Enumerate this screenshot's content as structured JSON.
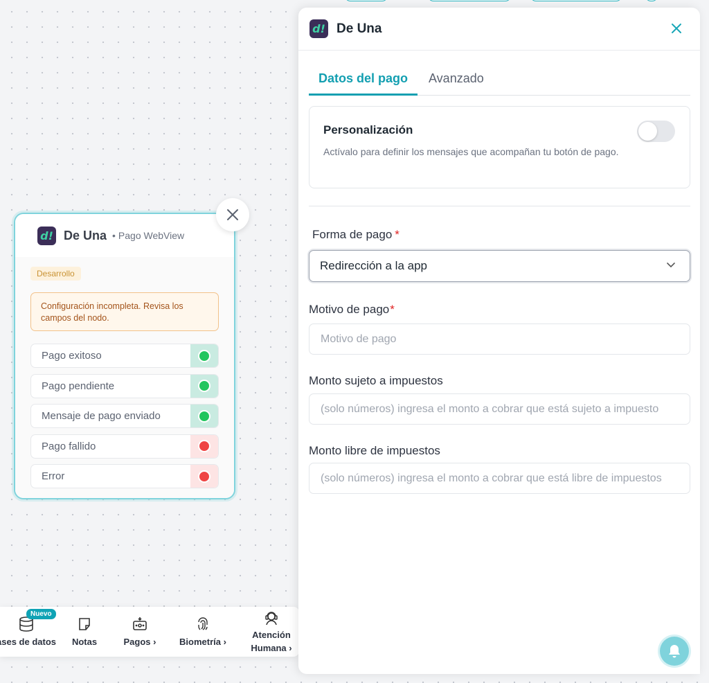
{
  "node": {
    "title": "De Una",
    "subtitle": "Pago WebView",
    "logo_text": "d!",
    "status_badge": "Desarrollo",
    "warning": "Configuración incompleta. Revisa los campos del nodo.",
    "outputs": [
      {
        "label": "Pago exitoso",
        "status": "success"
      },
      {
        "label": "Pago pendiente",
        "status": "success"
      },
      {
        "label": "Mensaje de pago enviado",
        "status": "success"
      },
      {
        "label": "Pago fallido",
        "status": "error"
      },
      {
        "label": "Error",
        "status": "error"
      }
    ]
  },
  "toolbar": {
    "new_badge": "Nuevo",
    "items": [
      {
        "label": "ases de datos",
        "icon": "database-icon"
      },
      {
        "label": "Notas",
        "icon": "note-icon"
      },
      {
        "label": "Pagos ›",
        "icon": "payments-icon"
      },
      {
        "label": "Biometría ›",
        "icon": "fingerprint-icon"
      },
      {
        "label": "Atención",
        "label2": "Humana ›",
        "icon": "agent-icon"
      }
    ]
  },
  "panel": {
    "title": "De Una",
    "logo_text": "d!",
    "tabs": [
      {
        "label": "Datos del pago",
        "active": true
      },
      {
        "label": "Avanzado",
        "active": false
      }
    ],
    "personalization": {
      "title": "Personalización",
      "description": "Actívalo para definir los mensajes que acompañan tu botón de pago.",
      "enabled": false
    },
    "fields": {
      "payment_method": {
        "label": "Forma de pago",
        "required_mark": "*",
        "value": "Redirección a la app"
      },
      "payment_reason": {
        "label": "Motivo de pago",
        "required_mark": "*",
        "placeholder": "Motivo de pago"
      },
      "taxable_amount": {
        "label": "Monto sujeto a impuestos",
        "placeholder": "(solo números) ingresa el monto a cobrar que está sujeto a impuesto"
      },
      "tax_free_amount": {
        "label": "Monto libre de impuestos",
        "placeholder": "(solo números) ingresa el monto a cobrar que está libre de impuestos"
      }
    }
  },
  "colors": {
    "accent": "#139fb1",
    "success": "#22c55e",
    "error": "#ef4444",
    "logo_bg": "#3b2e58",
    "logo_fg": "#3fd0a4"
  }
}
